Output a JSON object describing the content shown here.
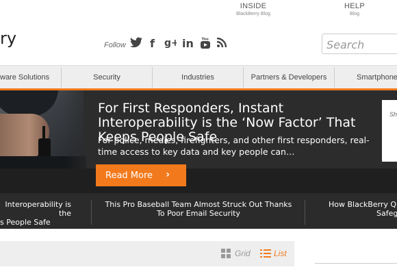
{
  "top_links": [
    {
      "title": "INSIDE",
      "subtitle": "BlackBerry Blog"
    },
    {
      "title": "HELP",
      "subtitle": "Blog"
    }
  ],
  "logo_text": "ry",
  "follow_label": "Follow",
  "social": {
    "twitter": "🐦",
    "facebook": "f",
    "googleplus": "g+",
    "linkedin": "in",
    "youtube": "You",
    "rss": "RSS"
  },
  "social_glyphs": {
    "twitter": "✦",
    "facebook": "f",
    "googleplus": "8+",
    "linkedin": "in",
    "youtube": "▶",
    "rss": "≋"
  },
  "search": {
    "placeholder": "Search"
  },
  "nav": [
    {
      "label": "ware Solutions"
    },
    {
      "label": "Security"
    },
    {
      "label": "Industries"
    },
    {
      "label": "Partners & Developers"
    },
    {
      "label": "Smartphone"
    }
  ],
  "hero": {
    "title": "For First Responders, Instant Interoperability is the ‘Now Factor’ That Keeps People Safe",
    "description": "For police, medics, firefighters, and other first responders, real-time access to key data and key people can…",
    "cta": "Read More",
    "cta_chevron": "›",
    "side_card_text": "Sh"
  },
  "strip": [
    {
      "line1": "Interoperability is the",
      "line2": "s People Safe"
    },
    {
      "line1": "This Pro Baseball Team Almost Struck Out Thanks",
      "line2": "To Poor Email Security"
    },
    {
      "line1": "How BlackBerry QNX",
      "line2": "Safeg"
    }
  ],
  "view_toggle": {
    "grid": "Grid",
    "list": "List",
    "active": "List"
  },
  "colors": {
    "accent": "#f27a1c",
    "hero_bg": "#2c2c2c",
    "nav_bg": "#eeeeee"
  }
}
